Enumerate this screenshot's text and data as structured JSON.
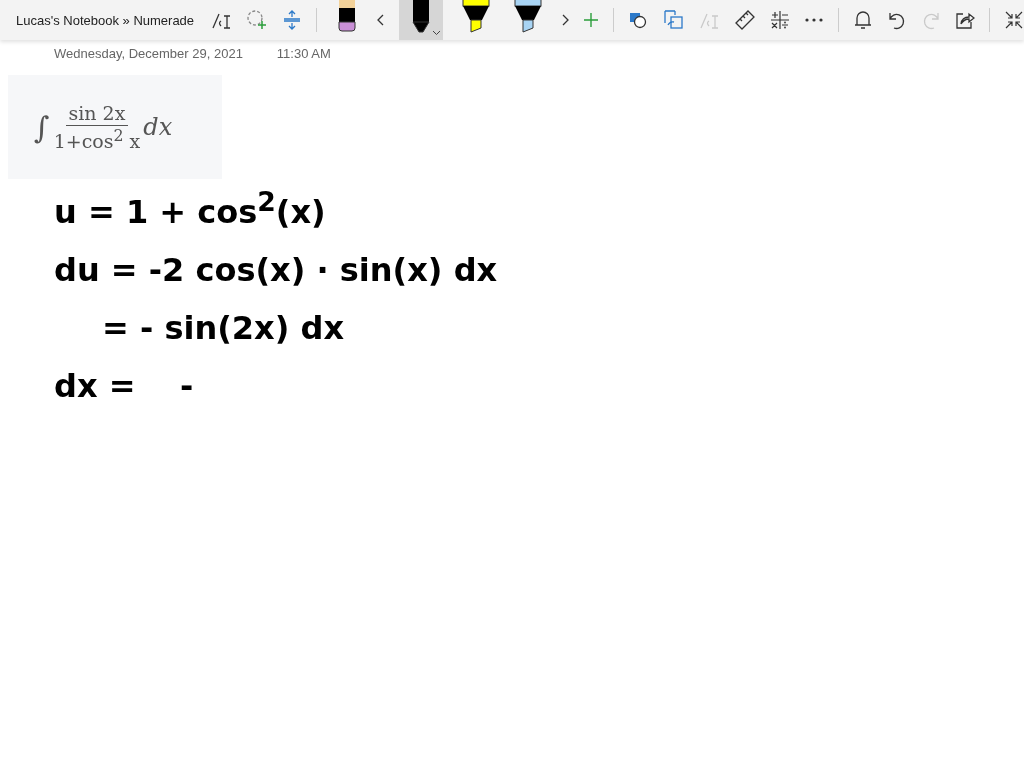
{
  "window": {
    "title": "Lucas's Notebook » Numerade"
  },
  "toolbar": {
    "left_tools": [
      {
        "kind": "ink-to-text",
        "disabled": false
      },
      {
        "kind": "lasso",
        "disabled": false
      },
      {
        "kind": "add-space",
        "disabled": false
      }
    ],
    "pens": [
      {
        "kind": "pen",
        "color": "#000000",
        "selected": false
      },
      {
        "kind": "pen",
        "color": "#000000",
        "selected": true
      },
      {
        "kind": "highlighter",
        "color": "#ffff00",
        "selected": false
      },
      {
        "kind": "highlighter",
        "color": "#a8d4f4",
        "selected": false
      }
    ],
    "right_tools": [
      {
        "kind": "shapes",
        "disabled": false
      },
      {
        "kind": "ink-to-shape",
        "disabled": false
      },
      {
        "kind": "ink-to-text",
        "disabled": true
      },
      {
        "kind": "ruler",
        "disabled": false
      },
      {
        "kind": "math",
        "disabled": false
      },
      {
        "kind": "more",
        "disabled": false
      },
      {
        "kind": "bell",
        "disabled": false
      },
      {
        "kind": "undo",
        "disabled": false
      },
      {
        "kind": "redo",
        "disabled": true
      },
      {
        "kind": "share",
        "disabled": false
      },
      {
        "kind": "collapse",
        "disabled": false
      }
    ]
  },
  "page": {
    "date": "Wednesday, December 29, 2021",
    "time": "11:30 AM",
    "formula": {
      "integral": "∫",
      "numerator": "sin 2x",
      "denominator": "1+cos$^{2}$ x",
      "differential": "dx"
    },
    "ink_lines": [
      {
        "kind": "line",
        "text": "u = 1 + cos$^{2}$(x)"
      },
      {
        "kind": "line",
        "text": "du = -2 cos(x) · sin(x) dx"
      },
      {
        "kind": "continued",
        "text": "= - sin(2x) dx"
      },
      {
        "kind": "line",
        "text": "dx =    -"
      }
    ]
  }
}
